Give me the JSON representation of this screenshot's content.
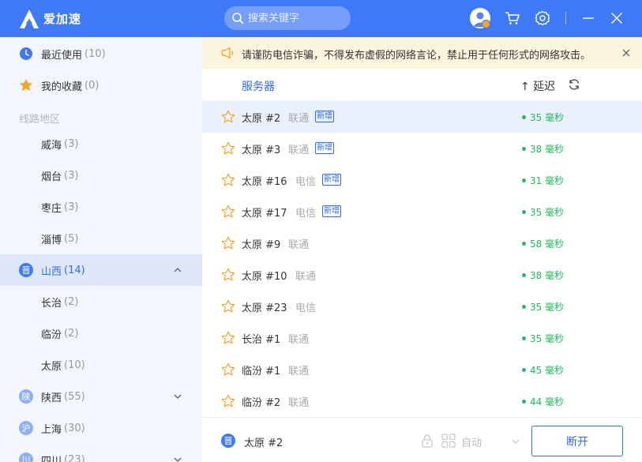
{
  "app": {
    "name": "爱加速"
  },
  "search": {
    "placeholder": "搜索关键字"
  },
  "colors": {
    "brand": "#4079f7",
    "accent": "#2f6bf0",
    "latency_green": "#22b85b",
    "notice_bg": "#fdf4de",
    "star": "#f5a623"
  },
  "sidebar": {
    "recent": {
      "label": "最近使用",
      "count": "(10)",
      "icon": "clock-icon"
    },
    "favorites": {
      "label": "我的收藏",
      "count": "(0)",
      "icon": "star-icon"
    },
    "heading": "线路地区",
    "regions": [
      {
        "label": "威海",
        "count": "(3)"
      },
      {
        "label": "烟台",
        "count": "(3)"
      },
      {
        "label": "枣庄",
        "count": "(3)"
      },
      {
        "label": "淄博",
        "count": "(5)"
      }
    ],
    "provinces": [
      {
        "badge": "晋",
        "label": "山西",
        "count": "(14)",
        "expanded": true,
        "badge_color": "#4079f7",
        "children": [
          {
            "label": "长治",
            "count": "(2)"
          },
          {
            "label": "临汾",
            "count": "(2)"
          },
          {
            "label": "太原",
            "count": "(10)"
          }
        ]
      },
      {
        "badge": "陕",
        "label": "陕西",
        "count": "(55)",
        "expanded": false,
        "badge_color": "#8fb0f5"
      },
      {
        "badge": "沪",
        "label": "上海",
        "count": "(30)",
        "expanded": false,
        "badge_color": "#8fb0f5"
      },
      {
        "badge": "川",
        "label": "四川",
        "count": "(23)",
        "expanded": false,
        "badge_color": "#8fb0f5"
      }
    ]
  },
  "notice": {
    "text": "请谨防电信诈骗，不得发布虚假的网络言论，禁止用于任何形式的网络攻击。"
  },
  "table": {
    "col_server": "服务器",
    "col_latency": "↑ 延迟",
    "rows": [
      {
        "name": "太原 #2",
        "isp": "联通",
        "new": "新增",
        "latency": "35 毫秒",
        "selected": true
      },
      {
        "name": "太原 #3",
        "isp": "联通",
        "new": "新增",
        "latency": "38 毫秒"
      },
      {
        "name": "太原 #16",
        "isp": "电信",
        "new": "新增",
        "latency": "31 毫秒"
      },
      {
        "name": "太原 #17",
        "isp": "电信",
        "new": "新增",
        "latency": "35 毫秒"
      },
      {
        "name": "太原 #9",
        "isp": "联通",
        "new": "",
        "latency": "58 毫秒"
      },
      {
        "name": "太原 #10",
        "isp": "联通",
        "new": "",
        "latency": "38 毫秒"
      },
      {
        "name": "太原 #23",
        "isp": "电信",
        "new": "",
        "latency": "35 毫秒"
      },
      {
        "name": "长治 #1",
        "isp": "联通",
        "new": "",
        "latency": "35 毫秒"
      },
      {
        "name": "临汾 #1",
        "isp": "联通",
        "new": "",
        "latency": "45 毫秒"
      },
      {
        "name": "临汾 #2",
        "isp": "联通",
        "new": "",
        "latency": "44 毫秒"
      }
    ]
  },
  "footer": {
    "badge": "晋",
    "server": "太原 #2",
    "mode": "自动",
    "disconnect": "断开"
  }
}
